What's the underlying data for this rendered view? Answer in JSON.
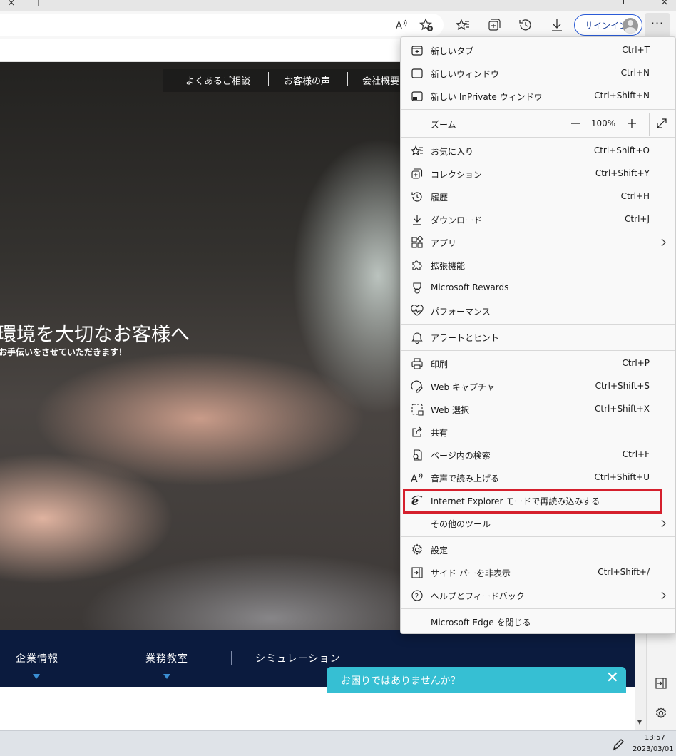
{
  "toolbar": {
    "signin_label": "サインイン",
    "icons": [
      "read-aloud-icon",
      "add-favorite-icon",
      "favorites-icon",
      "collections-icon",
      "history-icon",
      "downloads-icon",
      "more-icon"
    ],
    "more_label": "···"
  },
  "page": {
    "hero_nav": [
      "よくあるご相談",
      "お客様の声",
      "会社概要"
    ],
    "hero_title": "環境を大切なお客様へ",
    "hero_subtitle": "お手伝いをさせていただきます！",
    "bottom_nav": [
      "企業情報",
      "業務教室",
      "シミュレーション"
    ],
    "help_banner": "お困りではありませんか？",
    "help_close": "✕"
  },
  "menu": {
    "items": [
      {
        "label": "新しいタブ",
        "shortcut": "Ctrl+T",
        "icon": "new-tab-icon"
      },
      {
        "label": "新しいウィンドウ",
        "shortcut": "Ctrl+N",
        "icon": "new-window-icon"
      },
      {
        "label": "新しい InPrivate ウィンドウ",
        "shortcut": "Ctrl+Shift+N",
        "icon": "inprivate-icon"
      },
      {
        "label": "ズーム",
        "zoom_value": "100%",
        "icon": "zoom-icon"
      },
      {
        "label": "お気に入り",
        "shortcut": "Ctrl+Shift+O",
        "icon": "favorites-icon"
      },
      {
        "label": "コレクション",
        "shortcut": "Ctrl+Shift+Y",
        "icon": "collections-icon"
      },
      {
        "label": "履歴",
        "shortcut": "Ctrl+H",
        "icon": "history-icon"
      },
      {
        "label": "ダウンロード",
        "shortcut": "Ctrl+J",
        "icon": "download-icon"
      },
      {
        "label": "アプリ",
        "icon": "apps-icon"
      },
      {
        "label": "拡張機能",
        "icon": "extensions-icon"
      },
      {
        "label": "Microsoft Rewards",
        "icon": "rewards-icon"
      },
      {
        "label": "パフォーマンス",
        "icon": "performance-icon"
      },
      {
        "label": "アラートとヒント",
        "icon": "bell-icon"
      },
      {
        "label": "印刷",
        "shortcut": "Ctrl+P",
        "icon": "print-icon"
      },
      {
        "label": "Web キャプチャ",
        "shortcut": "Ctrl+Shift+S",
        "icon": "web-capture-icon"
      },
      {
        "label": "Web 選択",
        "shortcut": "Ctrl+Shift+X",
        "icon": "web-select-icon"
      },
      {
        "label": "共有",
        "icon": "share-icon"
      },
      {
        "label": "ページ内の検索",
        "shortcut": "Ctrl+F",
        "icon": "find-icon"
      },
      {
        "label": "音声で読み上げる",
        "shortcut": "Ctrl+Shift+U",
        "icon": "read-aloud-icon"
      },
      {
        "label": "Internet Explorer モードで再読み込みする",
        "icon": "ie-icon"
      },
      {
        "label": "その他のツール",
        "icon": ""
      },
      {
        "label": "設定",
        "icon": "settings-icon"
      },
      {
        "label": "サイド バーを非表示",
        "shortcut": "Ctrl+Shift+/",
        "icon": "sidebar-icon"
      },
      {
        "label": "ヘルプとフィードバック",
        "icon": "help-icon"
      },
      {
        "label": "Microsoft Edge を閉じる",
        "icon": ""
      }
    ]
  },
  "taskbar": {
    "time": "13:57",
    "date": "2023/03/01"
  }
}
